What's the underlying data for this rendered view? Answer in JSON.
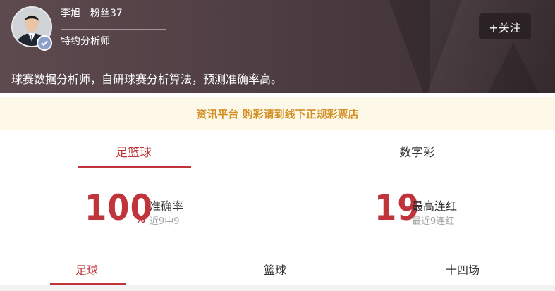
{
  "profile": {
    "name": "李旭",
    "fans": "粉丝37",
    "role": "特约分析师",
    "follow_label": "+关注",
    "intro": "球赛数据分析师，自研球赛分析算法，预测准确率高。"
  },
  "notice": "资讯平台 购彩请到线下正规彩票店",
  "tabs": [
    {
      "label": "足篮球",
      "active": true
    },
    {
      "label": "数字彩",
      "active": false
    }
  ],
  "stats": {
    "accuracy": {
      "value": "100",
      "unit": "%",
      "label": "准确率",
      "sub": "近9中9"
    },
    "streak": {
      "value": "19",
      "label": "最高连红",
      "sub": "最近9连红"
    }
  },
  "subtabs": [
    {
      "label": "足球",
      "active": true
    },
    {
      "label": "篮球",
      "active": false
    },
    {
      "label": "十四场",
      "active": false
    }
  ],
  "colors": {
    "accent": "#c0353b",
    "notice_text": "#d28f24",
    "notice_bg": "#fdf8e8"
  },
  "icons": {
    "avatar": "user-avatar",
    "verify": "verified-badge-icon"
  }
}
